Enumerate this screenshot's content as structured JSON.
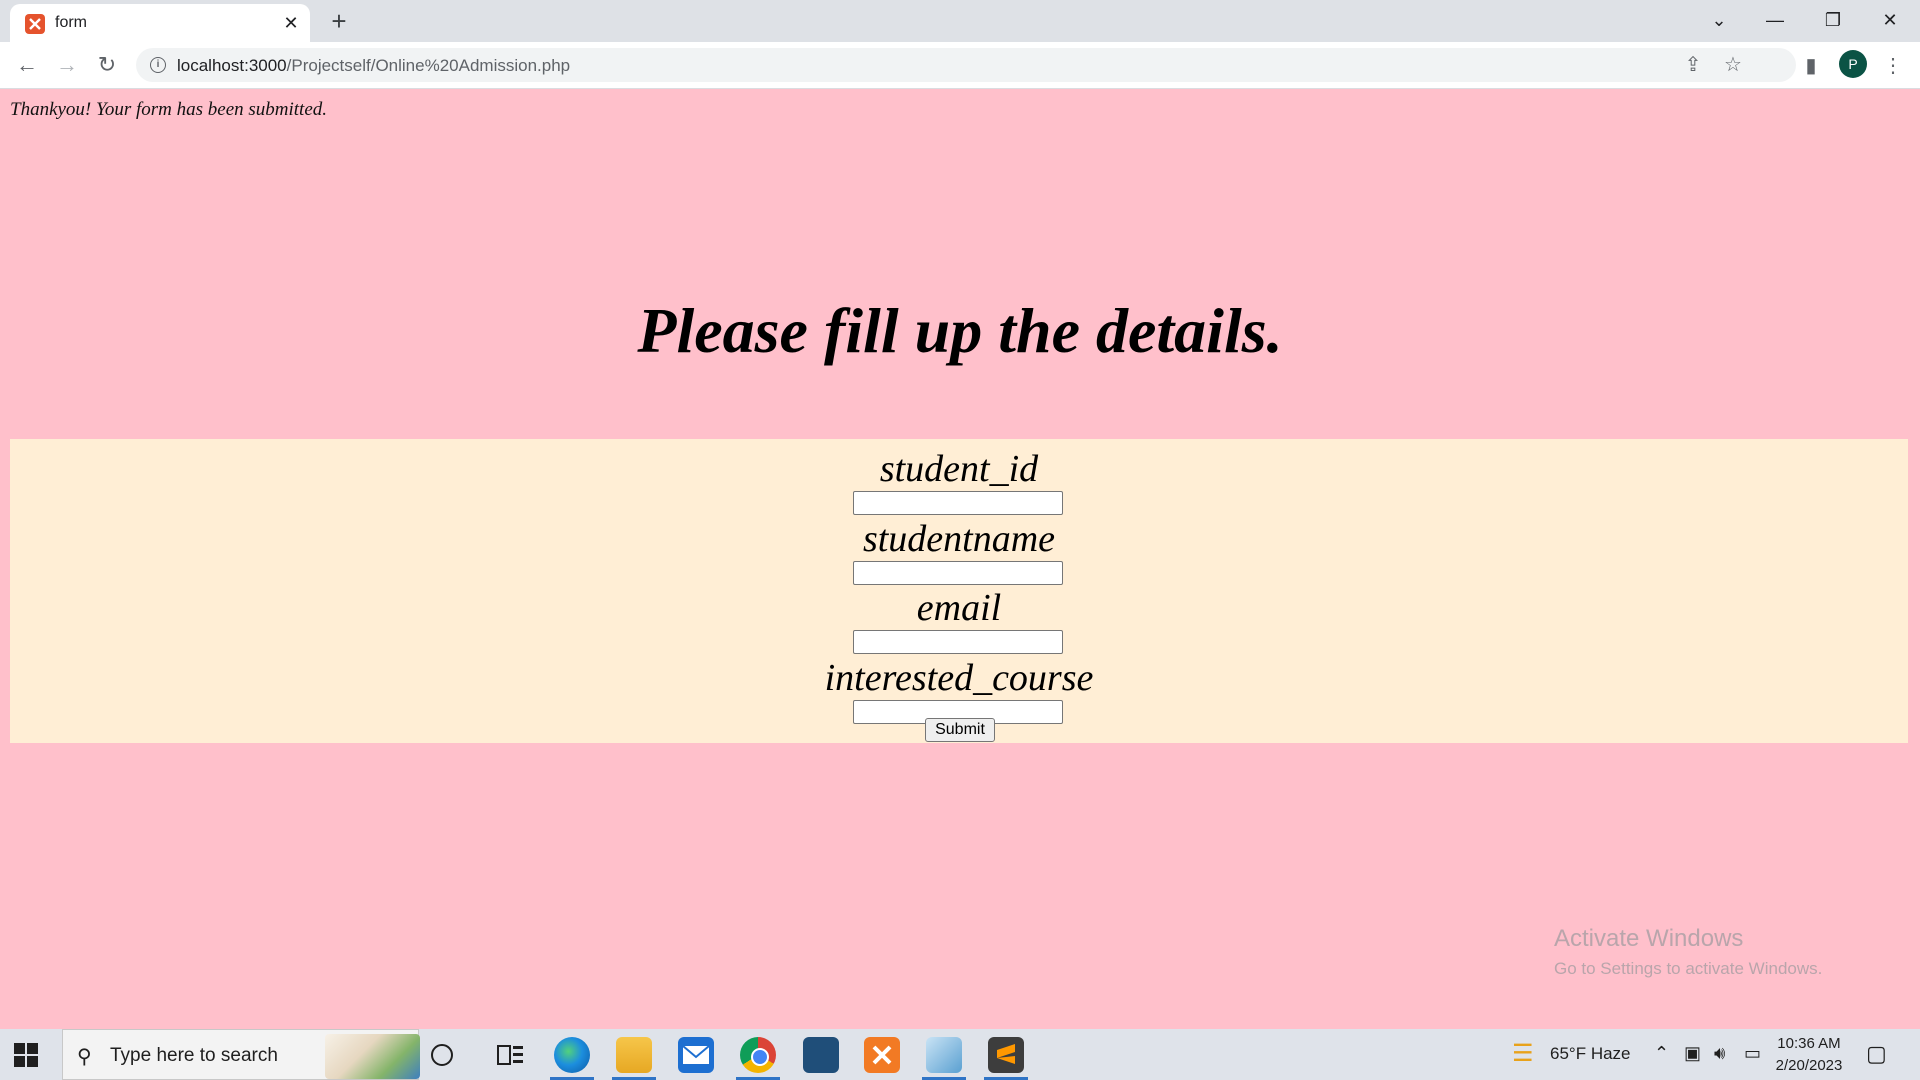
{
  "browser": {
    "tab_title": "form",
    "tab_close": "✕",
    "new_tab": "+",
    "url_host": "localhost:3000",
    "url_path": "/Projectself/Online%20Admission.php",
    "profile_initial": "P",
    "window_controls": [
      "⌄",
      "—",
      "❐",
      "✕"
    ]
  },
  "page": {
    "message": "Thankyou! Your form has been submitted.",
    "heading": "Please fill up the details.",
    "fields": [
      {
        "label": "student_id",
        "value": ""
      },
      {
        "label": "studentname",
        "value": ""
      },
      {
        "label": "email",
        "value": ""
      },
      {
        "label": "interested_course",
        "value": ""
      }
    ],
    "submit_label": "Submit",
    "background_color": "#ffc0cb",
    "panel_color": "#ffeed5"
  },
  "watermark": {
    "line1": "Activate Windows",
    "line2": "Go to Settings to activate Windows."
  },
  "taskbar": {
    "search_placeholder": "Type here to search",
    "weather": "65°F  Haze",
    "time": "10:36 AM",
    "date": "2/20/2023",
    "apps": [
      "cortana-icon",
      "task-view-icon",
      "edge-icon",
      "file-explorer-icon",
      "mail-icon",
      "chrome-icon",
      "mysql-workbench-icon",
      "xampp-icon",
      "notepad-icon",
      "sublime-text-icon"
    ]
  }
}
